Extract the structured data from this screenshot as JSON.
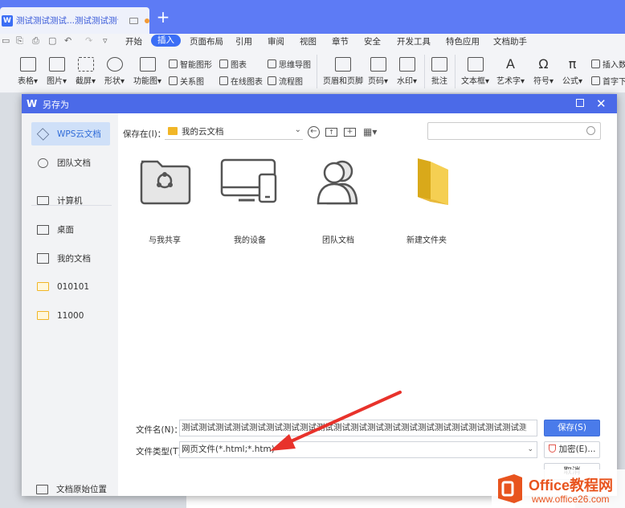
{
  "tabbar": {
    "doc_title": "测试测试测试...测试测试测试",
    "new_tab": "+",
    "accent": "#5d7bf5"
  },
  "menu": {
    "items": [
      "开始",
      "插入",
      "页面布局",
      "引用",
      "审阅",
      "视图",
      "章节",
      "安全",
      "开发工具",
      "特色应用",
      "文档助手"
    ],
    "active": "插入"
  },
  "ribbon": {
    "big": [
      "表格",
      "图片",
      "截屏",
      "形状",
      "功能图",
      "页眉和页脚",
      "页码",
      "水印",
      "批注",
      "文本框",
      "艺术字",
      "符号",
      "公式"
    ],
    "small": [
      "智能图形",
      "图表",
      "思维导图",
      "关系图",
      "在线图表",
      "流程图",
      "插入数",
      "首字下"
    ]
  },
  "dialog": {
    "title": "另存为",
    "sidebar": [
      {
        "label": "WPS云文档",
        "icon": "cloud-cube-icon",
        "active": true
      },
      {
        "label": "团队文档",
        "icon": "team-icon"
      },
      {
        "label": "计算机",
        "icon": "computer-icon"
      },
      {
        "label": "桌面",
        "icon": "desktop-icon"
      },
      {
        "label": "我的文档",
        "icon": "my-documents-icon"
      },
      {
        "label": "010101",
        "icon": "folder-icon"
      },
      {
        "label": "11000",
        "icon": "folder-icon"
      }
    ],
    "original_location": "文档原始位置",
    "save_in_label": "保存在(I)：",
    "location": "我的云文档",
    "search_placeholder": "",
    "tiles": [
      {
        "label": "与我共享",
        "icon": "shared-folder-icon"
      },
      {
        "label": "我的设备",
        "icon": "devices-icon"
      },
      {
        "label": "团队文档",
        "icon": "team-docs-icon"
      },
      {
        "label": "新建文件夹",
        "icon": "new-folder-icon"
      }
    ],
    "file_name_label": "文件名(N)：",
    "file_name_value": "测试测试测试测试测试测试测试测试测试测试测试测试测试测试测试测试测试测试测试测试测试测试测试测试",
    "file_type_label": "文件类型(T)：",
    "file_type_value": "网页文件(*.html;*.htm)",
    "save_button": "保存(S)",
    "encrypt_button": "加密(E)...",
    "cancel_button": "取消"
  },
  "watermark": {
    "brand": "Office教程网",
    "url": "www.office26.com"
  },
  "colors": {
    "dialog_title": "#4b6ae8",
    "primary_button": "#4a7bea",
    "annotation_arrow": "#e8322b",
    "folder": "#f1b627"
  }
}
